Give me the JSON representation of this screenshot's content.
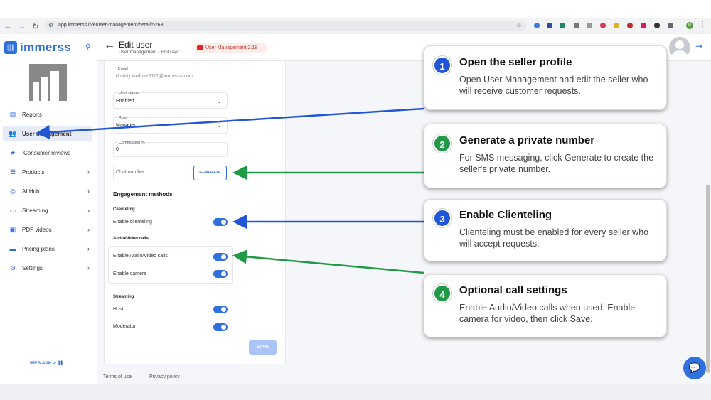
{
  "browser": {
    "url": "app.immerss.live/user-management/detail/5263",
    "profile_initial": "P"
  },
  "sidebar": {
    "logo_text": "immerss",
    "items": [
      {
        "label": "Reports",
        "icon": "reports-icon"
      },
      {
        "label": "User management",
        "icon": "users-icon"
      },
      {
        "label": "Consumer reviews",
        "icon": "star-icon"
      },
      {
        "label": "Products",
        "icon": "list-icon"
      },
      {
        "label": "AI Hub",
        "icon": "ai-icon"
      },
      {
        "label": "Streaming",
        "icon": "monitor-icon"
      },
      {
        "label": "PDP videos",
        "icon": "video-icon"
      },
      {
        "label": "Pricing plans",
        "icon": "card-icon"
      },
      {
        "label": "Settings",
        "icon": "gear-icon"
      }
    ],
    "web_app_label": "WEB APP"
  },
  "header": {
    "title": "Edit user",
    "breadcrumb": "User management - Edit user",
    "recording_label": "User Management 2:18"
  },
  "form": {
    "email_label": "Email",
    "email_value": "dmitriy.kozlov+1111@immerss.com",
    "status_label": "User status",
    "status_value": "Enabled",
    "role_label": "Role",
    "role_value": "Manager",
    "commission_label": "Commission %",
    "commission_value": "0",
    "chat_number_placeholder": "Chat number",
    "generate_label": "GENERATE",
    "engagement_title": "Engagement methods",
    "clienteling_title": "Clienteling",
    "enable_clienteling": "Enable clienteling",
    "av_title": "Audio/Video calls",
    "enable_av": "Enable Audio/Video calls",
    "enable_camera": "Enable camera",
    "streaming_title": "Streaming",
    "host": "Host",
    "moderator": "Moderator",
    "save_label": "SAVE"
  },
  "footer": {
    "terms": "Terms of use",
    "privacy": "Privacy policy"
  },
  "callouts": [
    {
      "num": "1",
      "title": "Open the seller profile",
      "desc": "Open User Management and edit the seller who will receive customer requests."
    },
    {
      "num": "2",
      "title": "Generate a private number",
      "desc": "For SMS messaging, click Generate to create the seller's private number."
    },
    {
      "num": "3",
      "title": "Enable Clienteling",
      "desc": "Clienteling must be enabled for every seller who will accept requests."
    },
    {
      "num": "4",
      "title": "Optional call settings",
      "desc": "Enable Audio/Video calls when used. Enable camera for video, then click Save."
    }
  ],
  "colors": {
    "accent": "#2f6fde",
    "callout_blue": "#2157d6",
    "callout_green": "#1f9a46"
  }
}
